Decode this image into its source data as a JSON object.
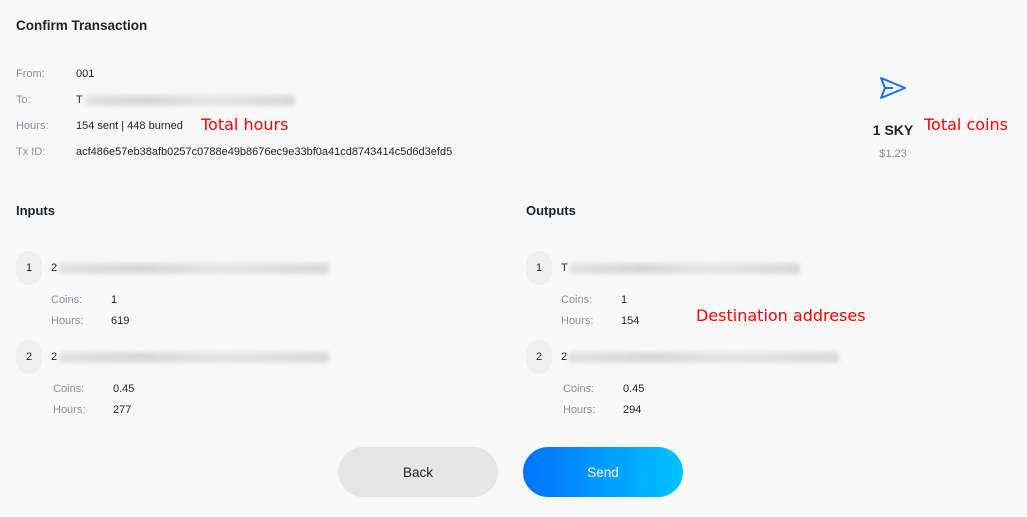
{
  "title": "Confirm Transaction",
  "info": {
    "from_label": "From:",
    "from_value": "001",
    "to_label": "To:",
    "to_value": "T",
    "hours_label": "Hours:",
    "hours_value": "154 sent | 448 burned",
    "txid_label": "Tx ID:",
    "txid_value": "acf486e57eb38afb0257c0788e49b8676ec9e33bf0a41cd8743414c5d6d3efd5"
  },
  "summary": {
    "amount": "1 SKY",
    "fiat": "$1.23",
    "icon": "send-icon",
    "accent_color": "#0072ff"
  },
  "annotations": {
    "total_hours": "Total hours",
    "total_coins": "Total coins",
    "destination": "Destination addreses",
    "color": "#ff0000"
  },
  "inputs": {
    "title": "Inputs",
    "coins_label": "Coins:",
    "hours_label": "Hours:",
    "items": [
      {
        "num": "1",
        "address": "2",
        "coins": "1",
        "hours": "619"
      },
      {
        "num": "2",
        "address": "2",
        "coins": "0.45",
        "hours": "277"
      }
    ]
  },
  "outputs": {
    "title": "Outputs",
    "coins_label": "Coins:",
    "hours_label": "Hours:",
    "items": [
      {
        "num": "1",
        "address": "T",
        "coins": "1",
        "hours": "154"
      },
      {
        "num": "2",
        "address": "2",
        "coins": "0.45",
        "hours": "294"
      }
    ]
  },
  "buttons": {
    "back": "Back",
    "send": "Send"
  }
}
